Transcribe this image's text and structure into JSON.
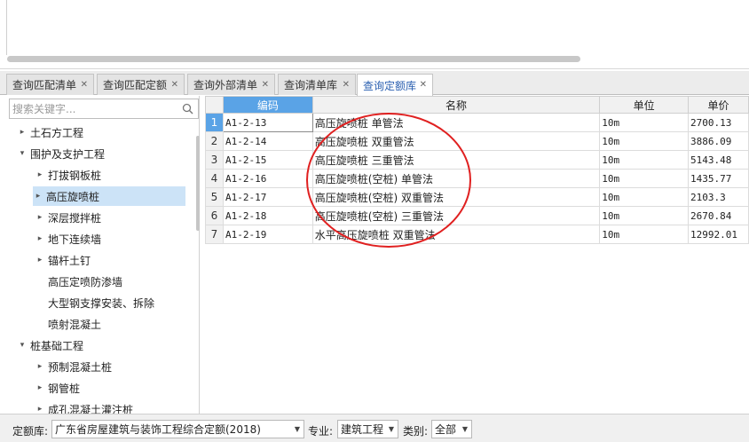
{
  "tabs": [
    {
      "label": "查询匹配清单"
    },
    {
      "label": "查询匹配定额"
    },
    {
      "label": "查询外部清单"
    },
    {
      "label": "查询清单库"
    },
    {
      "label": "查询定额库",
      "active": true
    }
  ],
  "search": {
    "placeholder": "搜索关键字..."
  },
  "tree": [
    {
      "label": "土石方工程",
      "level": 0,
      "state": "collapsed"
    },
    {
      "label": "围护及支护工程",
      "level": 0,
      "state": "expanded"
    },
    {
      "label": "打拔钢板桩",
      "level": 1,
      "state": "collapsed"
    },
    {
      "label": "高压旋喷桩",
      "level": 1,
      "state": "collapsed",
      "selected": true
    },
    {
      "label": "深层搅拌桩",
      "level": 1,
      "state": "collapsed"
    },
    {
      "label": "地下连续墙",
      "level": 1,
      "state": "collapsed"
    },
    {
      "label": "锚杆土钉",
      "level": 1,
      "state": "collapsed"
    },
    {
      "label": "高压定喷防渗墙",
      "level": 1,
      "state": "leaf"
    },
    {
      "label": "大型钢支撑安装、拆除",
      "level": 1,
      "state": "leaf"
    },
    {
      "label": "喷射混凝土",
      "level": 1,
      "state": "leaf"
    },
    {
      "label": "桩基础工程",
      "level": 0,
      "state": "expanded"
    },
    {
      "label": "预制混凝土桩",
      "level": 1,
      "state": "collapsed"
    },
    {
      "label": "钢管桩",
      "level": 1,
      "state": "collapsed"
    },
    {
      "label": "成孔混凝土灌注桩",
      "level": 1,
      "state": "collapsed"
    }
  ],
  "grid": {
    "headers": {
      "code": "编码",
      "name": "名称",
      "unit": "单位",
      "price": "单价"
    },
    "rows": [
      {
        "n": "1",
        "code": "A1-2-13",
        "name": "高压旋喷桩 单管法",
        "unit": "10m",
        "price": "2700.13"
      },
      {
        "n": "2",
        "code": "A1-2-14",
        "name": "高压旋喷桩 双重管法",
        "unit": "10m",
        "price": "3886.09"
      },
      {
        "n": "3",
        "code": "A1-2-15",
        "name": "高压旋喷桩 三重管法",
        "unit": "10m",
        "price": "5143.48"
      },
      {
        "n": "4",
        "code": "A1-2-16",
        "name": "高压旋喷桩(空桩) 单管法",
        "unit": "10m",
        "price": "1435.77"
      },
      {
        "n": "5",
        "code": "A1-2-17",
        "name": "高压旋喷桩(空桩) 双重管法",
        "unit": "10m",
        "price": "2103.3"
      },
      {
        "n": "6",
        "code": "A1-2-18",
        "name": "高压旋喷桩(空桩) 三重管法",
        "unit": "10m",
        "price": "2670.84"
      },
      {
        "n": "7",
        "code": "A1-2-19",
        "name": "水平高压旋喷桩 双重管法",
        "unit": "10m",
        "price": "12992.01"
      }
    ]
  },
  "bottom": {
    "library_label": "定额库:",
    "library_value": "广东省房屋建筑与装饰工程综合定额(2018)",
    "specialty_label": "专业:",
    "specialty_value": "建筑工程",
    "category_label": "类别:",
    "category_value": "全部"
  },
  "colors": {
    "accent": "#5aa3e6",
    "annotation": "#e02020",
    "selected_row": "#cce3f7"
  }
}
